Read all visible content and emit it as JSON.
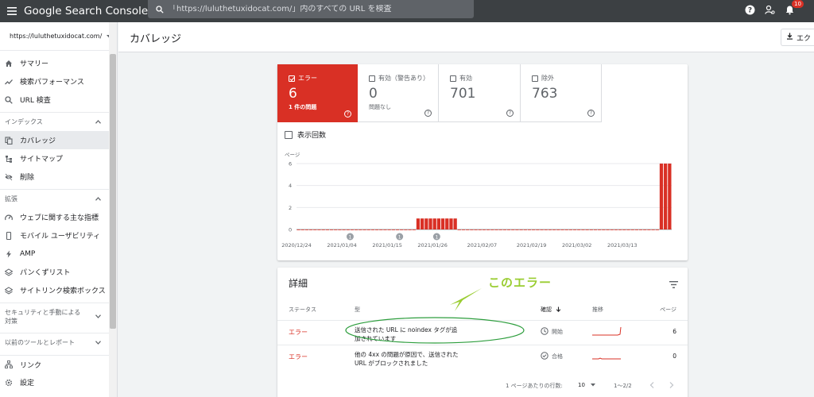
{
  "app": {
    "title": "Google Search Console",
    "notification_count": "10"
  },
  "search": {
    "placeholder": "「https://luluthetuxidocat.com/」内のすべての URL を検査"
  },
  "sidebar": {
    "property": "https://luluthetuxidocat.com/",
    "top_items": [
      {
        "label": "サマリー",
        "icon": "home-icon"
      },
      {
        "label": "検索パフォーマンス",
        "icon": "trending-up-icon"
      },
      {
        "label": "URL 検査",
        "icon": "search-icon"
      }
    ],
    "sections": [
      {
        "title": "インデックス",
        "items": [
          {
            "label": "カバレッジ",
            "icon": "file-copy-icon"
          },
          {
            "label": "サイトマップ",
            "icon": "sitemap-icon"
          },
          {
            "label": "削除",
            "icon": "visibility-off-icon"
          }
        ]
      },
      {
        "title": "拡張",
        "items": [
          {
            "label": "ウェブに関する主な指標",
            "icon": "speed-icon"
          },
          {
            "label": "モバイル ユーザビリティ",
            "icon": "smartphone-icon"
          },
          {
            "label": "AMP",
            "icon": "bolt-icon"
          },
          {
            "label": "パンくずリスト",
            "icon": "layers-icon"
          },
          {
            "label": "サイトリンク検索ボックス",
            "icon": "layers-icon"
          }
        ]
      }
    ],
    "security_title": "セキュリティと手動による対策",
    "legacy_title": "以前のツールとレポート",
    "bottom_items": [
      {
        "label": "リンク",
        "icon": "link-icon"
      },
      {
        "label": "設定",
        "icon": "gear-icon"
      }
    ]
  },
  "header": {
    "title": "カバレッジ",
    "export_label": "エク"
  },
  "tiles": [
    {
      "label": "エラー",
      "value": "6",
      "sub": "1 件の問題",
      "checked": true
    },
    {
      "label": "有効（警告あり）",
      "value": "0",
      "sub": "問題なし",
      "checked": false
    },
    {
      "label": "有効",
      "value": "701",
      "sub": "",
      "checked": false
    },
    {
      "label": "除外",
      "value": "763",
      "sub": "",
      "checked": false
    }
  ],
  "impressions_label": "表示回数",
  "chart_data": {
    "type": "bar",
    "ylabel": "ページ",
    "yticks": [
      0,
      2,
      4,
      6
    ],
    "ylim": [
      0,
      6
    ],
    "xticks": [
      "2020/12/24",
      "2021/01/04",
      "2021/01/15",
      "2021/01/26",
      "2021/02/07",
      "2021/02/19",
      "2021/03/02",
      "2021/03/13"
    ],
    "x_start": "2020/12/24",
    "x_end": "2021/03/25",
    "values": [
      0,
      0,
      0,
      0,
      0,
      0,
      0,
      0,
      0,
      0,
      0,
      0,
      0,
      0,
      0,
      0,
      0,
      0,
      0,
      0,
      0,
      0,
      0,
      0,
      0,
      0,
      0,
      0,
      0,
      1,
      1,
      1,
      1,
      1,
      1,
      1,
      1,
      1,
      1,
      0,
      0,
      0,
      0,
      0,
      0,
      0,
      0,
      0,
      0,
      0,
      0,
      0,
      0,
      0,
      0,
      0,
      0,
      0,
      0,
      0,
      0,
      0,
      0,
      0,
      0,
      0,
      0,
      0,
      0,
      0,
      0,
      0,
      0,
      0,
      0,
      0,
      0,
      0,
      0,
      0,
      0,
      0,
      0,
      0,
      0,
      0,
      0,
      0,
      6,
      6,
      6
    ],
    "annotations": [
      {
        "date": "2021/01/06",
        "label": "1"
      },
      {
        "date": "2021/01/18",
        "label": "1"
      },
      {
        "date": "2021/01/27",
        "label": "1"
      }
    ],
    "color": "#d93025"
  },
  "details": {
    "title": "詳細",
    "columns": {
      "status": "ステータス",
      "type": "型",
      "validation": "確認",
      "trend": "推移",
      "pages": "ページ"
    },
    "rows": [
      {
        "status": "エラー",
        "type": "送信された URL に noindex タグが追加されています",
        "validation": "開始",
        "validation_icon": "clock-icon",
        "pages": "6"
      },
      {
        "status": "エラー",
        "type": "他の 4xx の問題が原因で、送信された URL がブロックされました",
        "validation": "合格",
        "validation_icon": "check-circle-icon",
        "pages": "0"
      }
    ],
    "pagination": {
      "rows_per_page_label": "1 ページあたりの行数:",
      "rows_per_page": "10",
      "range": "1～2/2"
    }
  },
  "annotation": {
    "text": "このエラー",
    "color": "#9acd32"
  }
}
